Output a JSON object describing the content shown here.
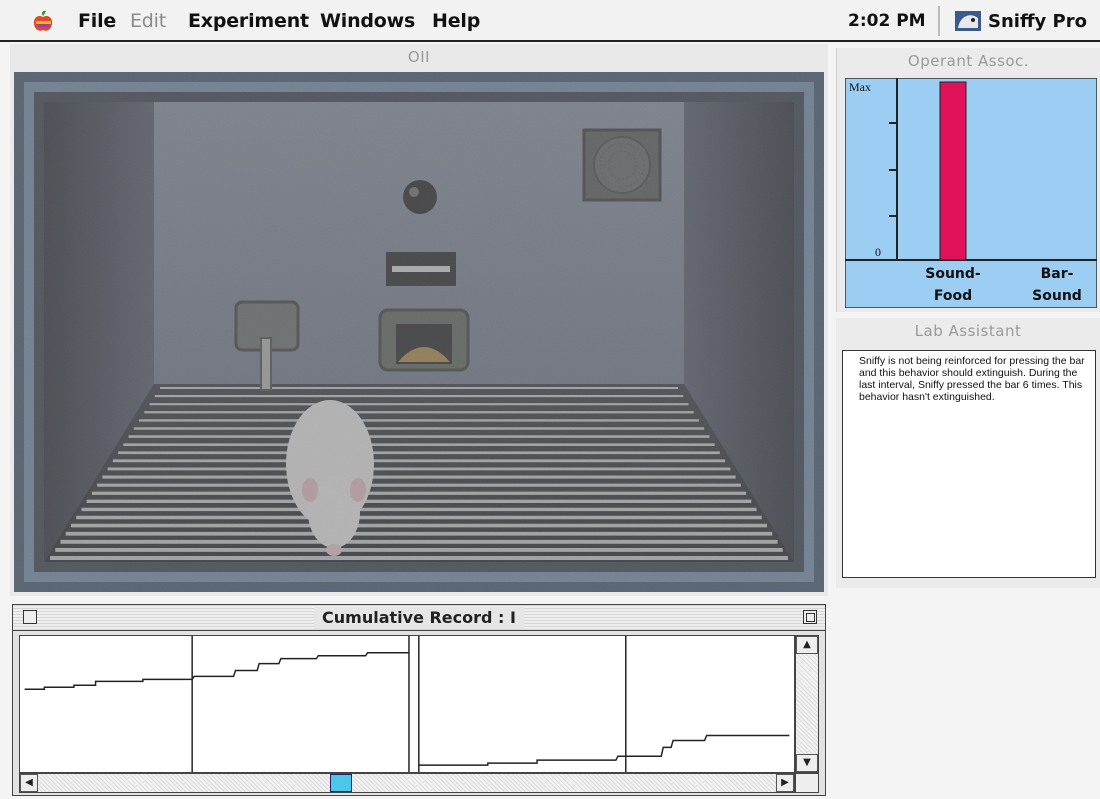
{
  "menubar": {
    "items": [
      {
        "label": "File",
        "enabled": true
      },
      {
        "label": "Edit",
        "enabled": false
      },
      {
        "label": "Experiment",
        "enabled": true
      },
      {
        "label": "Windows",
        "enabled": true
      },
      {
        "label": "Help",
        "enabled": true
      }
    ],
    "clock": "2:02 PM",
    "app_name": "Sniffy Pro"
  },
  "chamber": {
    "title": "OII"
  },
  "operant_assoc": {
    "title": "Operant Assoc.",
    "y_labels": {
      "max": "Max",
      "zero": "0"
    },
    "categories": [
      {
        "line1": "Sound-",
        "line2": "Food"
      },
      {
        "line1": "Bar-",
        "line2": "Sound"
      }
    ],
    "bar_levels": [
      1.0,
      0.0
    ],
    "bar_color": "#e0135a",
    "background_color": "#9ccdf2"
  },
  "lab_assistant": {
    "title": "Lab Assistant",
    "message": "Sniffy is not being reinforced for pressing the bar and this behavior should extinguish. During the last interval, Sniffy pressed the bar 6 times.  This behavior hasn't extinguished."
  },
  "cumulative_record": {
    "title": "Cumulative Record : I",
    "accent_color": "#4bc7ea"
  }
}
